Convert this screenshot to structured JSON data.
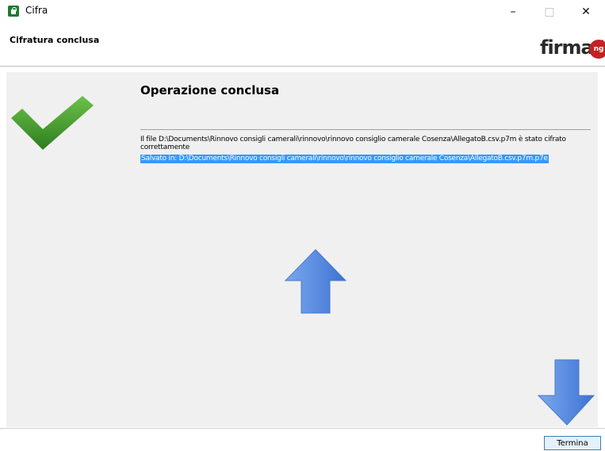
{
  "window": {
    "title": "Cifra",
    "minimize": "–",
    "maximize": "□",
    "close": "✕"
  },
  "header": {
    "step_title": "Cifratura conclusa",
    "logo_text": "firma4",
    "logo_badge": "ng"
  },
  "main": {
    "title": "Operazione conclusa",
    "message": "Il file D:\\Documents\\Rinnovo consigli camerali\\rinnovo\\rinnovo consiglio camerale Cosenza\\AllegatoB.csv.p7m è stato cifrato correttamente",
    "saved_path": "Salvato in: D:\\Documents\\Rinnovo consigli camerali\\rinnovo\\rinnovo consiglio camerale Cosenza\\AllegatoB.csv.p7m.p7e"
  },
  "footer": {
    "finish_label": "Termina"
  },
  "icons": {
    "success": "checkmark-icon",
    "annotation_up": "arrow-up-icon",
    "annotation_down": "arrow-down-icon"
  },
  "colors": {
    "check_green": "#3f9b2f",
    "selection_blue": "#3399ff",
    "arrow_blue": "#5b8fe0",
    "logo_red": "#c22323"
  }
}
